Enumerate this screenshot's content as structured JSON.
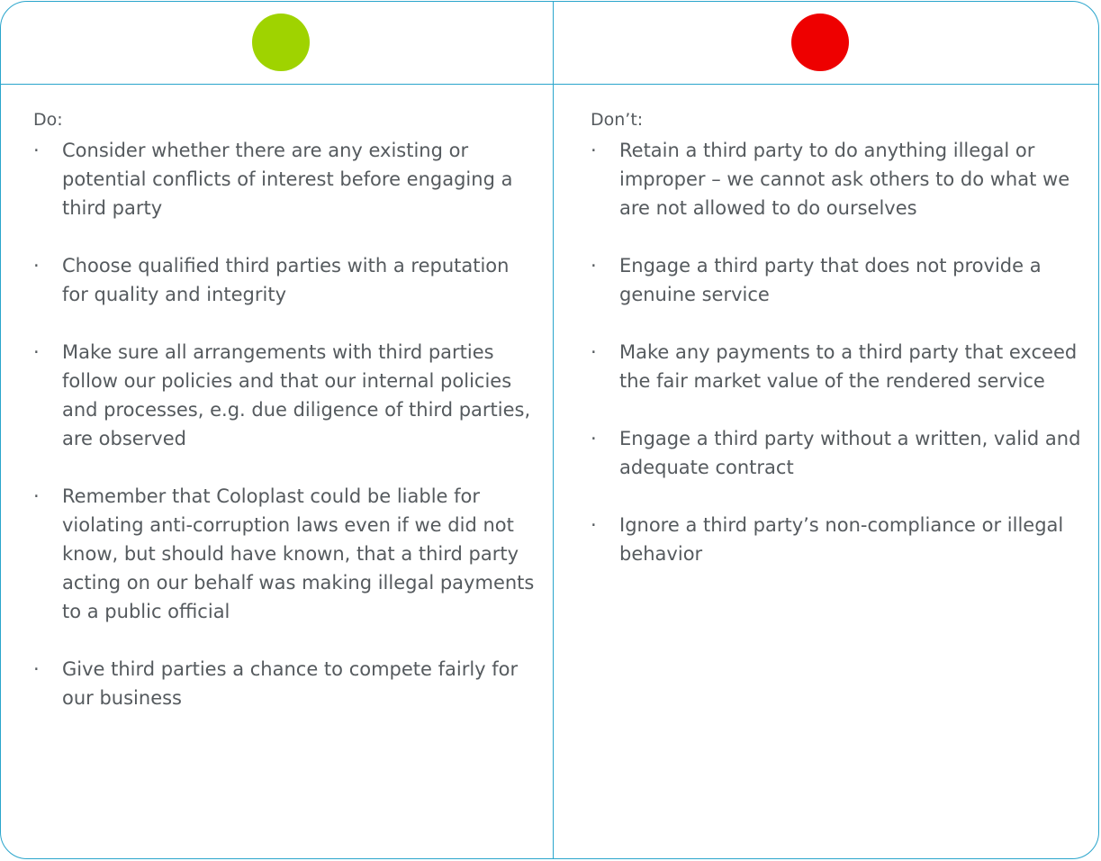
{
  "colors": {
    "border": "#2aa5cc",
    "do_circle": "#9fd300",
    "dont_circle": "#ee0000",
    "text": "#555a5e"
  },
  "do": {
    "icon": "green-circle-icon",
    "heading": "Do:",
    "bullet": "·",
    "items": [
      "Consider whether there are any existing or potential conflicts of interest before engaging a third party",
      "Choose qualified third parties with a reputation for quality and integrity",
      "Make sure all arrangements with third parties follow our policies and that our internal policies and processes, e.g. due diligence of third parties, are observed",
      "Remember that Coloplast could be liable for violating anti-corruption laws even if we did not know, but should have known, that a third party acting on our behalf was making illegal payments to a public official",
      "Give third parties a chance to compete fairly for our business"
    ]
  },
  "dont": {
    "icon": "red-circle-icon",
    "heading": "Don’t:",
    "bullet": "·",
    "items": [
      "Retain a third party to do anything illegal or improper – we cannot ask others to do what we are not allowed to do ourselves",
      "Engage a third party that does not provide a genuine service",
      "Make any payments to a third party that exceed the fair market value of the rendered service",
      "Engage a third party without a written, valid and adequate contract",
      "Ignore a third party’s non-compliance or illegal behavior"
    ]
  }
}
